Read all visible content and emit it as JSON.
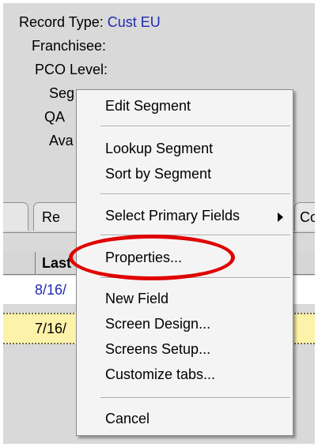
{
  "record": {
    "type_label": "Record Type:",
    "type_value": "Cust EU",
    "franchisee_label": "Franchisee:",
    "pco_label": "PCO Level:",
    "segment_label_partial": "Seg",
    "qa_label_partial": "QA",
    "ava_label_partial": "Ava"
  },
  "tabs": [
    {
      "label": "Re"
    },
    {
      "label": "Co"
    }
  ],
  "grid": {
    "header_partial": "Last",
    "rows": [
      {
        "date_partial": "8/16/"
      },
      {
        "date_partial": "7/16/"
      }
    ]
  },
  "context_menu": {
    "edit_segment": "Edit Segment",
    "lookup_segment": "Lookup Segment",
    "sort_by_segment": "Sort by Segment",
    "select_primary_fields": "Select Primary Fields",
    "properties": "Properties...",
    "new_field": "New Field",
    "screen_design": "Screen Design...",
    "screens_setup": "Screens Setup...",
    "customize_tabs": "Customize tabs...",
    "cancel": "Cancel"
  },
  "annotation": {
    "color": "#e00000"
  }
}
